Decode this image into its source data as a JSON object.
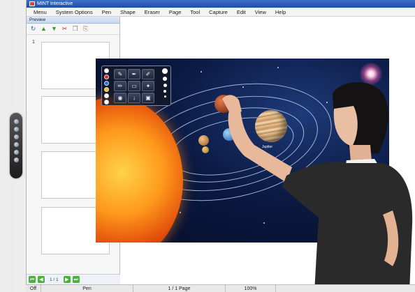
{
  "window": {
    "title": "MINT Interactive"
  },
  "menu": [
    "Menu",
    "System Options",
    "Pen",
    "Shape",
    "Eraser",
    "Page",
    "Tool",
    "Capture",
    "Edit",
    "View",
    "Help"
  ],
  "preview": {
    "header": "Preview",
    "first_page_number": "1",
    "page_indicator": "1 / 1"
  },
  "toolbar_icons": [
    "refresh-icon",
    "move-up-icon",
    "move-down-icon",
    "cut-icon",
    "copy-icon",
    "paste-icon"
  ],
  "canvas": {
    "planet_labels": {
      "jupiter": "Jupiter"
    }
  },
  "palette": {
    "colors": [
      "#ffffff",
      "#e02a2a",
      "#2a6ee0",
      "#f1c21c",
      "#f7f7f7",
      "#ffffff"
    ],
    "tool_icons": [
      "highlighter-icon",
      "pen-icon",
      "brush-icon",
      "marker-icon",
      "eraser-icon",
      "laser-pointer-icon",
      "fill-icon",
      "save-icon",
      "capture-icon"
    ]
  },
  "status": {
    "mode": "Off",
    "tool": "Pen",
    "page": "1 / 1 Page",
    "zoom": "100%"
  }
}
